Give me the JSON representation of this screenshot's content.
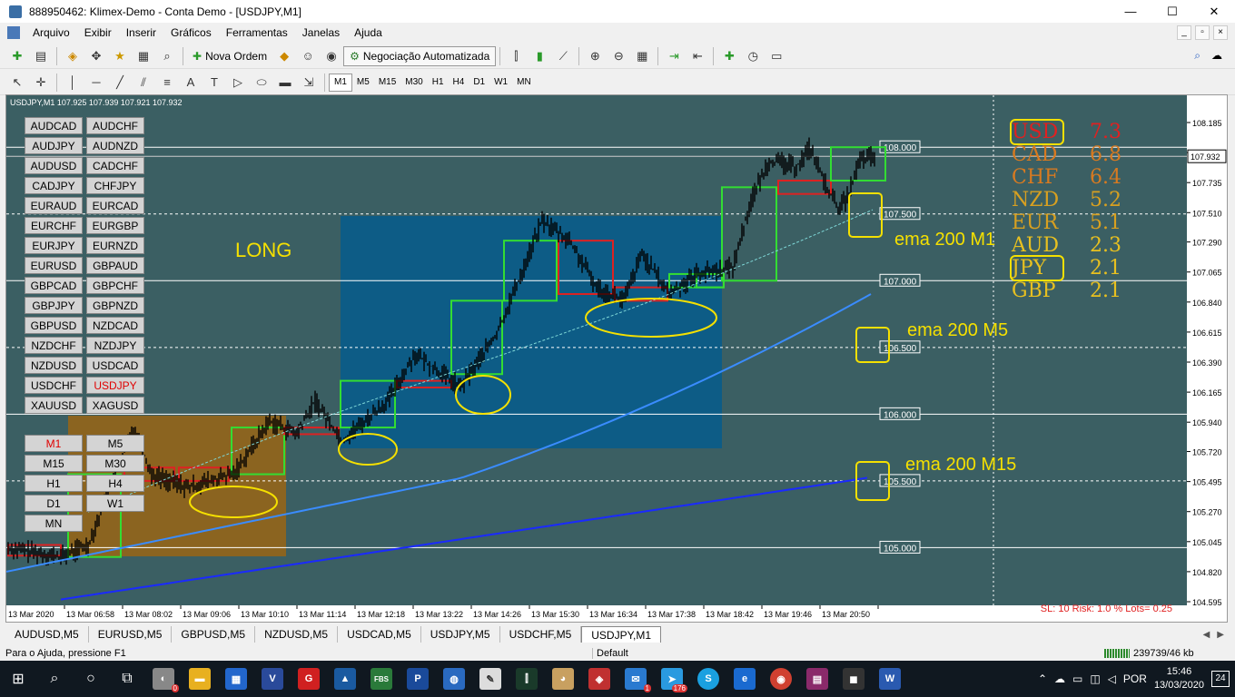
{
  "window": {
    "title": "888950462: Klimex-Demo - Conta Demo - [USDJPY,M1]",
    "min": "—",
    "max": "☐",
    "close": "✕"
  },
  "menu": [
    "Arquivo",
    "Exibir",
    "Inserir",
    "Gráficos",
    "Ferramentas",
    "Janelas",
    "Ajuda"
  ],
  "toolbar1": {
    "new_order": "Nova Ordem",
    "auto_trading": "Negociação Automatizada"
  },
  "toolbar2": {
    "timeframes": [
      "M1",
      "M5",
      "M15",
      "M30",
      "H1",
      "H4",
      "D1",
      "W1",
      "MN"
    ],
    "active_tf": "M1"
  },
  "chart": {
    "info": "USDJPY,M1  107.925 107.939 107.921 107.932",
    "symbols": [
      "AUDCAD",
      "AUDCHF",
      "AUDJPY",
      "AUDNZD",
      "AUDUSD",
      "CADCHF",
      "CADJPY",
      "CHFJPY",
      "EURAUD",
      "EURCAD",
      "EURCHF",
      "EURGBP",
      "EURJPY",
      "EURNZD",
      "EURUSD",
      "GBPAUD",
      "GBPCAD",
      "GBPCHF",
      "GBPJPY",
      "GBPNZD",
      "GBPUSD",
      "NZDCAD",
      "NZDCHF",
      "NZDJPY",
      "NZDUSD",
      "USDCAD",
      "USDCHF",
      "USDJPY",
      "XAUUSD",
      "XAGUSD"
    ],
    "active_symbol": "USDJPY",
    "tf_buttons": [
      "M1",
      "M5",
      "M15",
      "M30",
      "H1",
      "H4",
      "D1",
      "W1",
      "MN"
    ],
    "active_tf_button": "M1",
    "long_label": "LONG",
    "ema_labels": [
      "ema 200 M1",
      "ema 200 M5",
      "ema 200 M15"
    ],
    "strength": [
      {
        "cur": "USD",
        "val": "7.3",
        "color": "#e02020"
      },
      {
        "cur": "CAD",
        "val": "6.8",
        "color": "#d87a20"
      },
      {
        "cur": "CHF",
        "val": "6.4",
        "color": "#d87a20"
      },
      {
        "cur": "NZD",
        "val": "5.2",
        "color": "#d8a020"
      },
      {
        "cur": "EUR",
        "val": "5.1",
        "color": "#d8a020"
      },
      {
        "cur": "AUD",
        "val": "2.3",
        "color": "#e8c020"
      },
      {
        "cur": "JPY",
        "val": "2.1",
        "color": "#e8c020"
      },
      {
        "cur": "GBP",
        "val": "2.1",
        "color": "#e8c020"
      }
    ],
    "hlines": [
      {
        "price": "108.000"
      },
      {
        "price": "107.500"
      },
      {
        "price": "107.000"
      },
      {
        "price": "106.500"
      },
      {
        "price": "106.000"
      },
      {
        "price": "105.500"
      },
      {
        "price": "105.000"
      }
    ],
    "price_axis": [
      "108.185",
      "107.960",
      "107.735",
      "107.510",
      "107.290",
      "107.065",
      "106.840",
      "106.615",
      "106.390",
      "106.165",
      "105.940",
      "105.720",
      "105.495",
      "105.270",
      "105.045",
      "104.820",
      "104.595"
    ],
    "current_price": "107.932",
    "time_axis": [
      "13 Mar 2020",
      "13 Mar 06:58",
      "13 Mar 08:02",
      "13 Mar 09:06",
      "13 Mar 10:10",
      "13 Mar 11:14",
      "13 Mar 12:18",
      "13 Mar 13:22",
      "13 Mar 14:26",
      "13 Mar 15:30",
      "13 Mar 16:34",
      "13 Mar 17:38",
      "13 Mar 18:42",
      "13 Mar 19:46",
      "13 Mar 20:50"
    ],
    "sl_info": "SL: 10  Risk: 1.0 %  Lots= 0.25"
  },
  "tabs": [
    "AUDUSD,M5",
    "EURUSD,M5",
    "GBPUSD,M5",
    "NZDUSD,M5",
    "USDCAD,M5",
    "USDJPY,M5",
    "USDCHF,M5",
    "USDJPY,M1"
  ],
  "active_tab": "USDJPY,M1",
  "status": {
    "help": "Para o Ajuda, pressione F1",
    "profile": "Default",
    "traffic": "239739/46 kb"
  },
  "taskbar": {
    "lang": "POR",
    "time": "15:46",
    "date": "13/03/2020",
    "notifications": "24",
    "badge_176": "176",
    "badge_1": "1",
    "badge_0": "0"
  },
  "colors": {
    "chart_bg": "#3b5f63",
    "candle": "#000000",
    "ema_m1": "#7fd8d8",
    "ema_m5": "#3a8cff",
    "ema_m15": "#1a2aff",
    "box_bull": "#33dd33",
    "box_bear": "#dd2222",
    "zone_blue": "#0d5c86",
    "zone_orange": "#8b6420",
    "highlight": "#f5e000"
  }
}
